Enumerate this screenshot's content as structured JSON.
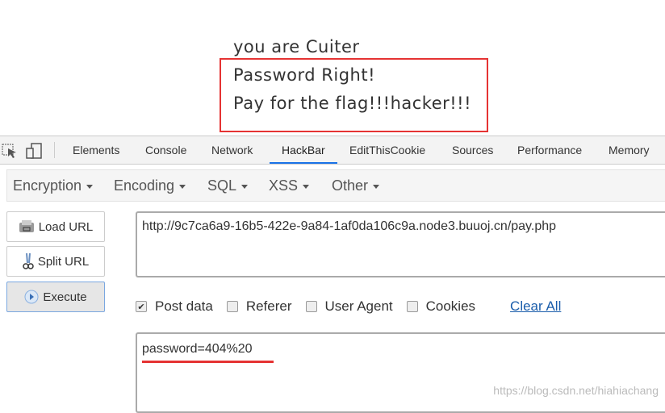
{
  "page": {
    "lines": [
      "you are Cuiter",
      "Password Right!",
      "Pay for the flag!!!hacker!!!"
    ],
    "highlight_color": "#e53333"
  },
  "devtools": {
    "tabs": [
      "Elements",
      "Console",
      "Network",
      "HackBar",
      "EditThisCookie",
      "Sources",
      "Performance",
      "Memory"
    ],
    "active_tab": "HackBar",
    "icons": [
      "inspect-element-icon",
      "device-toolbar-icon"
    ]
  },
  "hackbar": {
    "menus": [
      "Encryption",
      "Encoding",
      "SQL",
      "XSS",
      "Other"
    ],
    "buttons": {
      "load": "Load URL",
      "split": "Split URL",
      "execute": "Execute"
    },
    "url": "http://9c7ca6a9-16b5-422e-9a84-1af0da106c9a.node3.buuoj.cn/pay.php",
    "options": [
      {
        "label": "Post data",
        "checked": true
      },
      {
        "label": "Referer",
        "checked": false
      },
      {
        "label": "User Agent",
        "checked": false
      },
      {
        "label": "Cookies",
        "checked": false
      }
    ],
    "clear_all": "Clear All",
    "post_data": "password=404%20"
  },
  "watermark": "https://blog.csdn.net/hiahiachang"
}
